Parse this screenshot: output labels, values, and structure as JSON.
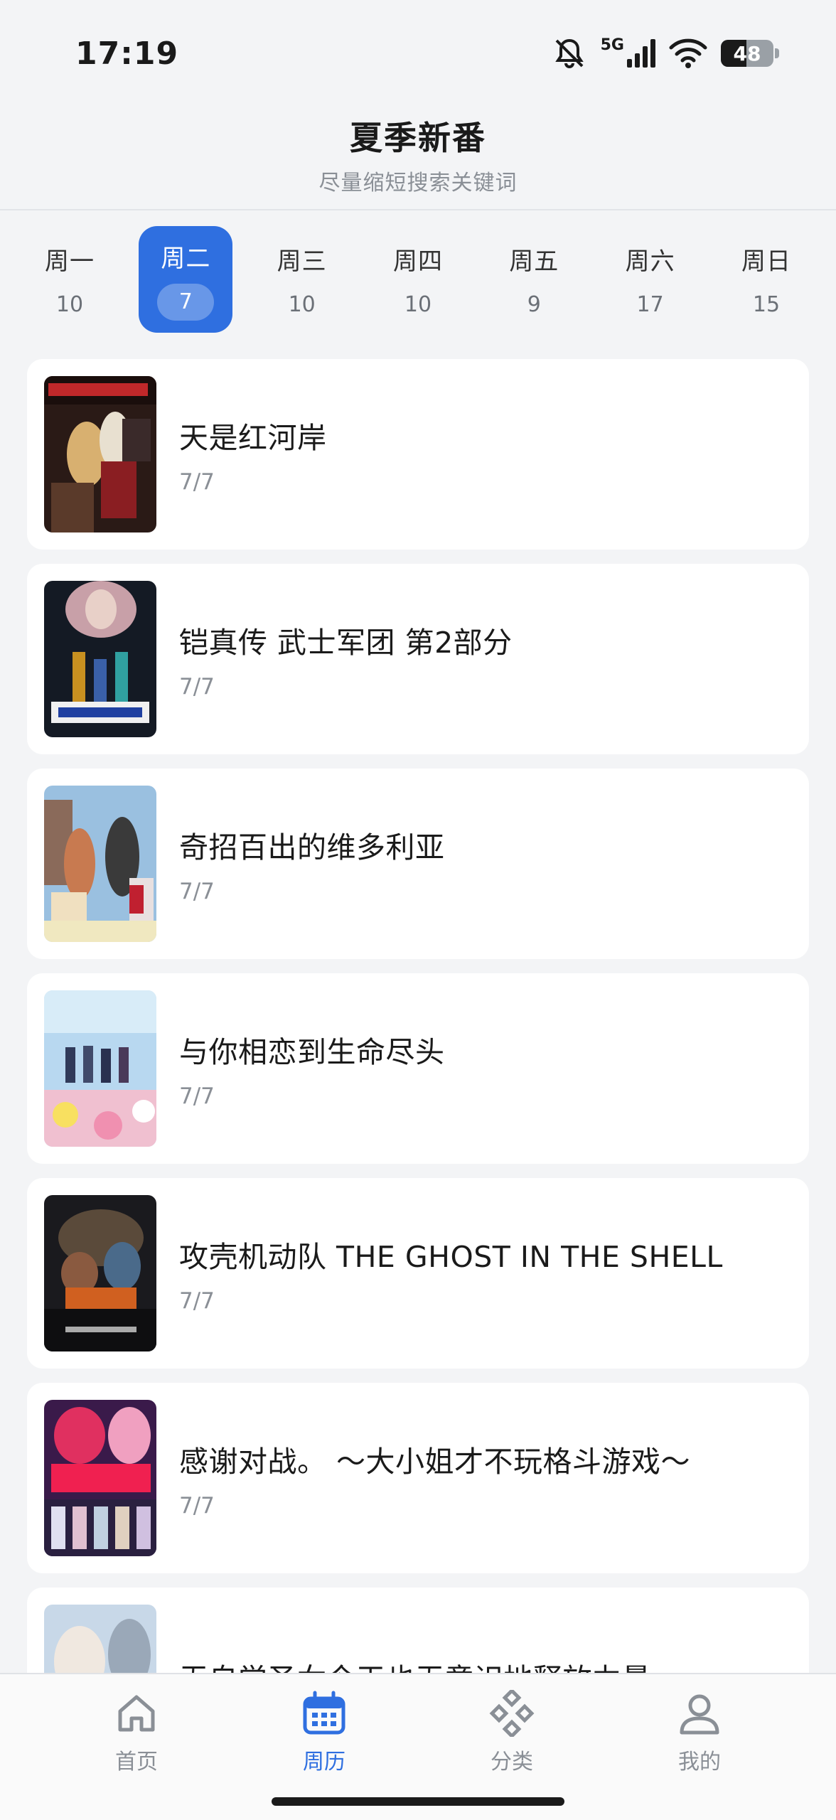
{
  "status_bar": {
    "time": "17:19",
    "network": "5G",
    "battery": "48",
    "battery_level": 0.48
  },
  "header": {
    "title": "夏季新番",
    "subtitle": "尽量缩短搜索关键词"
  },
  "days": [
    {
      "name": "周一",
      "count": "10"
    },
    {
      "name": "周二",
      "count": "7",
      "active": true
    },
    {
      "name": "周三",
      "count": "10"
    },
    {
      "name": "周四",
      "count": "10"
    },
    {
      "name": "周五",
      "count": "9"
    },
    {
      "name": "周六",
      "count": "17"
    },
    {
      "name": "周日",
      "count": "15"
    }
  ],
  "list": [
    {
      "title": "天是红河岸",
      "progress": "7/7"
    },
    {
      "title": "铠真传 武士军团 第2部分",
      "progress": "7/7"
    },
    {
      "title": "奇招百出的维多利亚",
      "progress": "7/7"
    },
    {
      "title": "与你相恋到生命尽头",
      "progress": "7/7"
    },
    {
      "title": "攻壳机动队 THE GHOST IN THE SHELL",
      "progress": "7/7"
    },
    {
      "title": "感谢对战。 ～大小姐才不玩格斗游戏～",
      "progress": "7/7"
    },
    {
      "title": "无自觉圣女今天也无意识地释放力量",
      "progress": ""
    }
  ],
  "tabs": [
    {
      "label": "首页",
      "icon": "home-icon"
    },
    {
      "label": "周历",
      "icon": "calendar-icon",
      "active": true
    },
    {
      "label": "分类",
      "icon": "category-icon"
    },
    {
      "label": "我的",
      "icon": "profile-icon"
    }
  ],
  "colors": {
    "accent": "#2f6fe0",
    "background": "#f3f4f6"
  }
}
